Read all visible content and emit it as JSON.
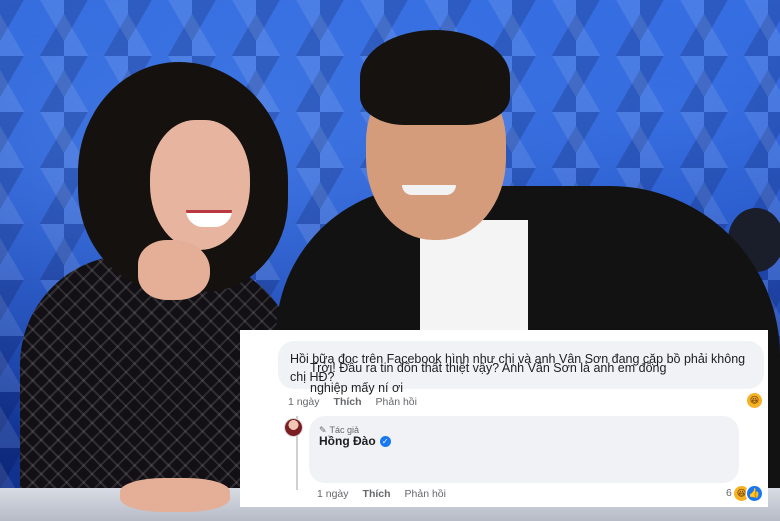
{
  "comment": {
    "text": "Hồi bữa đọc trên Facebook hình như chị và anh Vân Sơn đang cặp bồ phải không chị HĐ?",
    "time": "1 ngày",
    "like_label": "Thích",
    "reply_label": "Phản hồi",
    "reaction_icon": "haha-emoji-icon"
  },
  "reply": {
    "author_tag": "Tác giả",
    "author_name": "Hồng Đào",
    "text": "Trời! Đâu ra tin đồn thất thiệt vậy? Anh Vân Sơn là anh em đồng nghiệp mấy ní ơi",
    "time": "1 ngày",
    "like_label": "Thích",
    "reply_label": "Phản hồi",
    "reaction_count": "6",
    "reaction_icons": [
      "haha-emoji-icon",
      "like-icon"
    ]
  },
  "colors": {
    "bubble_bg": "#f0f2f5",
    "meta_text": "#65676b",
    "verified_blue": "#1877f2"
  }
}
